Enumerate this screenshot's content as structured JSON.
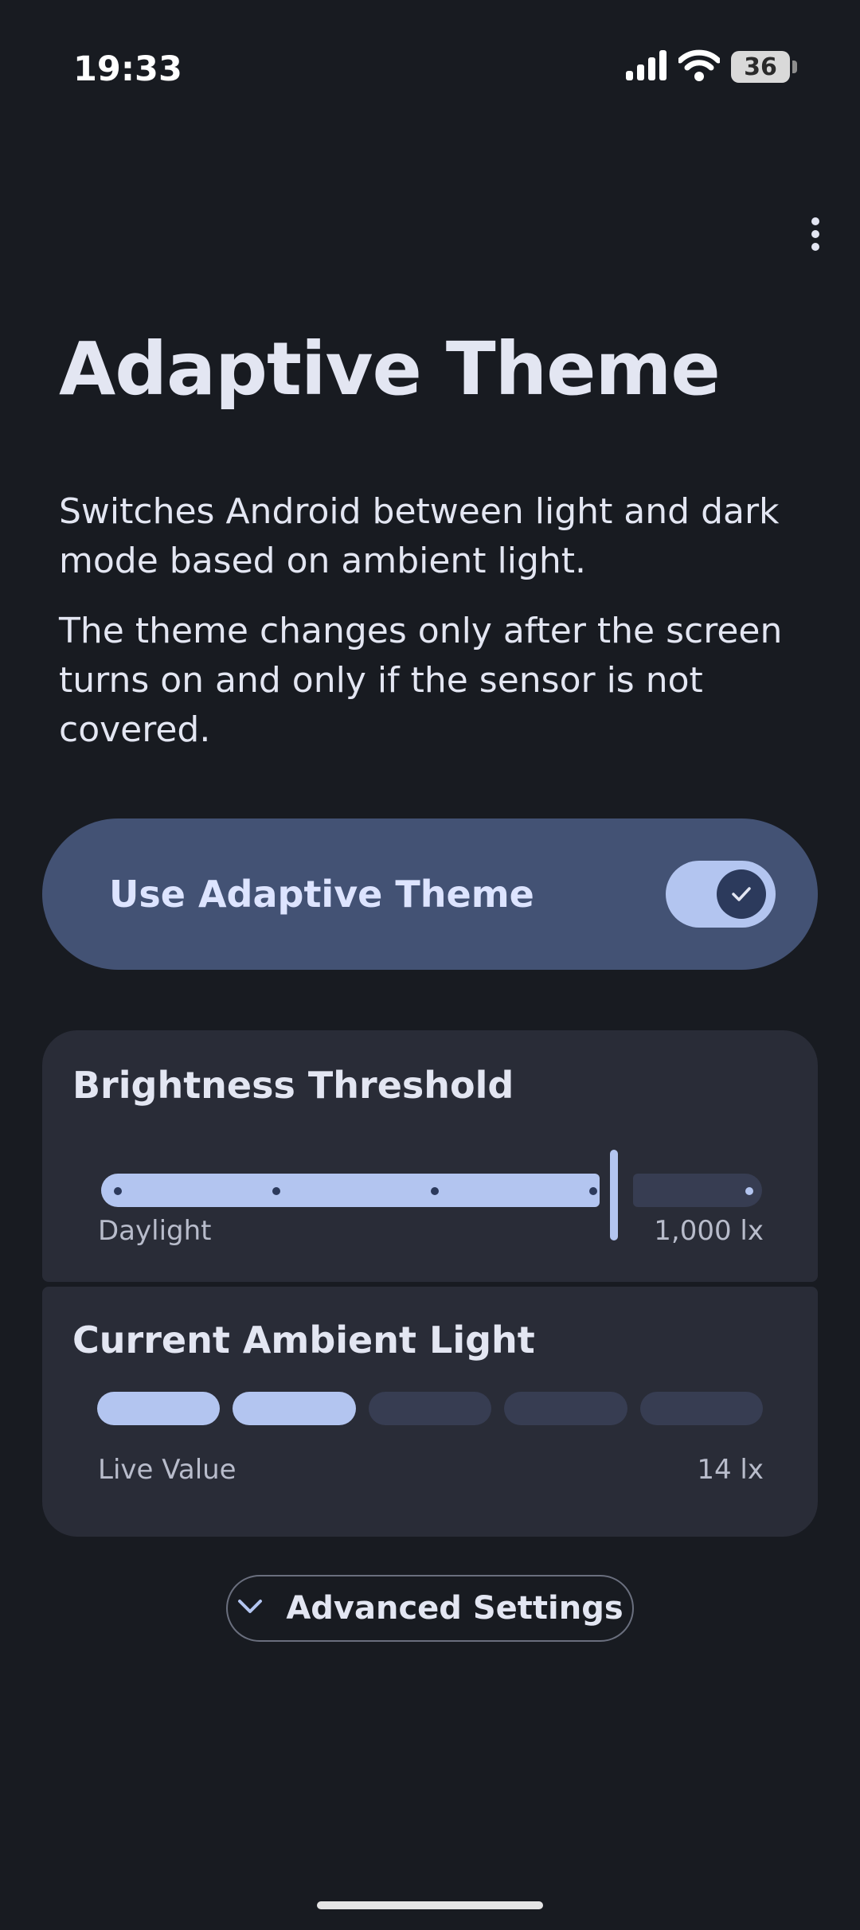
{
  "status_bar": {
    "time": "19:33",
    "battery_level": "36",
    "icons": [
      "signal-icon",
      "wifi-icon",
      "battery-icon"
    ]
  },
  "app_bar": {
    "menu_icon": "more-vert-icon"
  },
  "header": {
    "title": "Adaptive Theme",
    "description_1": "Switches Android between light and dark mode based on ambient light.",
    "description_2": "The theme changes only after the screen turns on and only if the sensor is not covered."
  },
  "master_toggle": {
    "label": "Use Adaptive Theme",
    "checked": true
  },
  "threshold": {
    "title": "Brightness Threshold",
    "label_left": "Daylight",
    "value_text": "1,000 lx",
    "step_count": 6,
    "selected_fraction": 0.8
  },
  "ambient": {
    "title": "Current Ambient Light",
    "label_left": "Live Value",
    "value_text": "14 lx",
    "segments_total": 5,
    "segments_filled": 2
  },
  "advanced": {
    "label": "Advanced Settings",
    "icon": "chevron-down-icon"
  },
  "colors": {
    "background": "#181b21",
    "accent": "#b3c5f0",
    "toggle_card": "#435274",
    "card": "#292c37"
  }
}
